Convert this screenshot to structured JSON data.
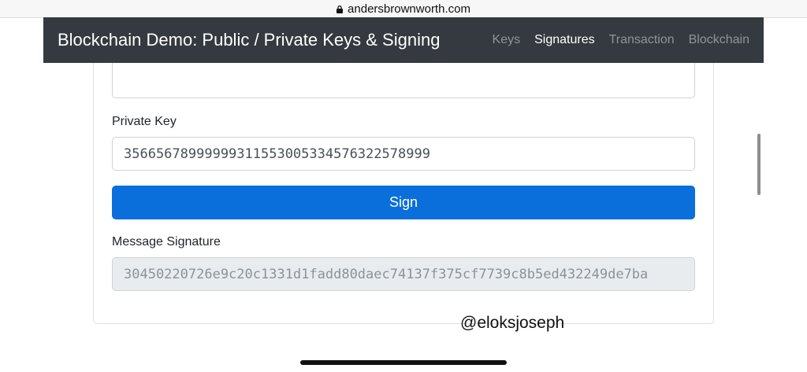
{
  "browser": {
    "url": "andersbrownworth.com"
  },
  "navbar": {
    "brand": "Blockchain Demo: Public / Private Keys & Signing",
    "links": [
      {
        "label": "Keys",
        "active": false
      },
      {
        "label": "Signatures",
        "active": true
      },
      {
        "label": "Transaction",
        "active": false
      },
      {
        "label": "Blockchain",
        "active": false
      }
    ]
  },
  "form": {
    "private_key_label": "Private Key",
    "private_key_value": "35665678999999311553005334576322578999",
    "sign_button": "Sign",
    "signature_label": "Message Signature",
    "signature_value": "30450220726e9c20c1331d1fadd80daec74137f375cf7739c8b5ed432249de7ba"
  },
  "overlay": {
    "watermark": "@eloksjoseph"
  },
  "colors": {
    "navbar_bg": "#343a40",
    "button_bg": "#0a6fda",
    "readonly_bg": "#e9ecef"
  }
}
